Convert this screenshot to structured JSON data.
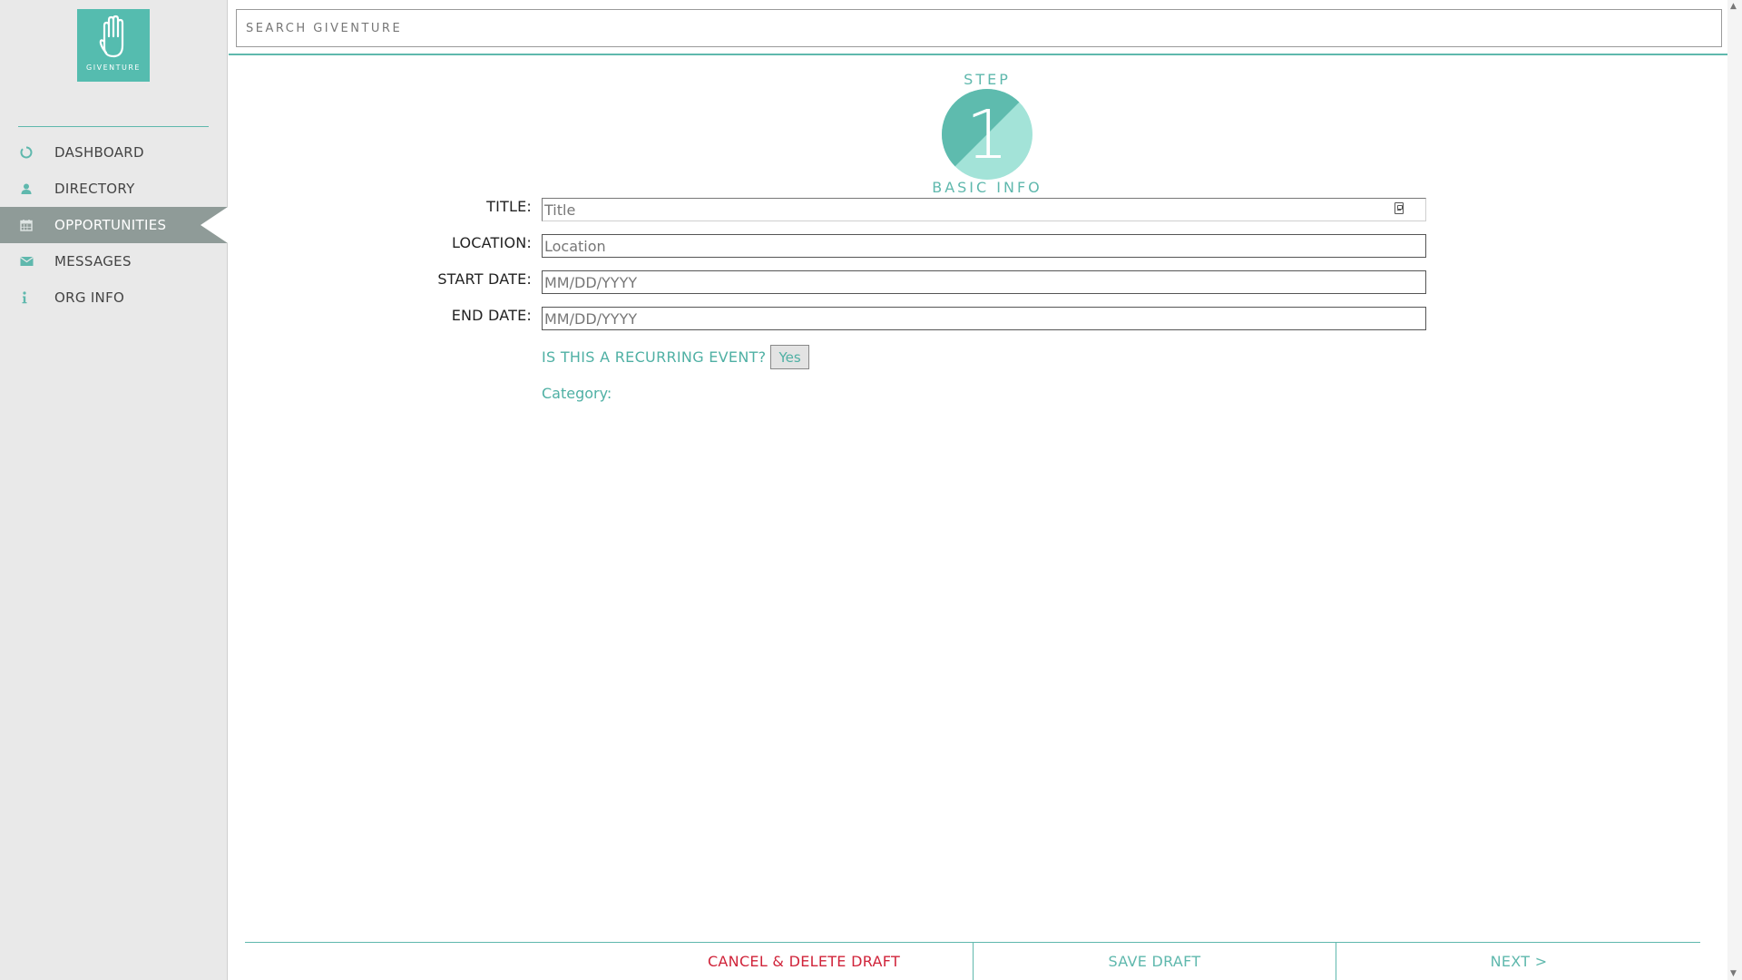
{
  "brand": {
    "name": "GIVENTURE",
    "logo_icon": "hand-icon",
    "color": "#55bcaf"
  },
  "search": {
    "placeholder": "SEARCH GIVENTURE",
    "value": ""
  },
  "sidebar": {
    "items": [
      {
        "label": "DASHBOARD",
        "icon": "dashboard-circle-icon",
        "active": false
      },
      {
        "label": "DIRECTORY",
        "icon": "user-icon",
        "active": false
      },
      {
        "label": "OPPORTUNITIES",
        "icon": "calendar-icon",
        "active": true
      },
      {
        "label": "MESSAGES",
        "icon": "envelope-icon",
        "active": false
      },
      {
        "label": "ORG INFO",
        "icon": "info-icon",
        "active": false
      }
    ]
  },
  "step": {
    "label": "STEP",
    "number": "1",
    "subtitle": "BASIC INFO"
  },
  "form": {
    "title": {
      "label": "TITLE:",
      "placeholder": "Title",
      "value": ""
    },
    "location": {
      "label": "LOCATION:",
      "placeholder": "Location",
      "value": ""
    },
    "start_date": {
      "label": "START DATE:",
      "placeholder": "MM/DD/YYYY",
      "value": ""
    },
    "end_date": {
      "label": "END DATE:",
      "placeholder": "MM/DD/YYYY",
      "value": ""
    },
    "recurring": {
      "label": "IS THIS A RECURRING EVENT?",
      "button": "Yes"
    },
    "category": {
      "label": "Category:"
    }
  },
  "footer": {
    "cancel": "CANCEL & DELETE DRAFT",
    "save": "SAVE DRAFT",
    "next": "NEXT >"
  },
  "colors": {
    "accent": "#5fb8ad",
    "danger": "#d0243a",
    "active_nav": "#8f9b98"
  }
}
